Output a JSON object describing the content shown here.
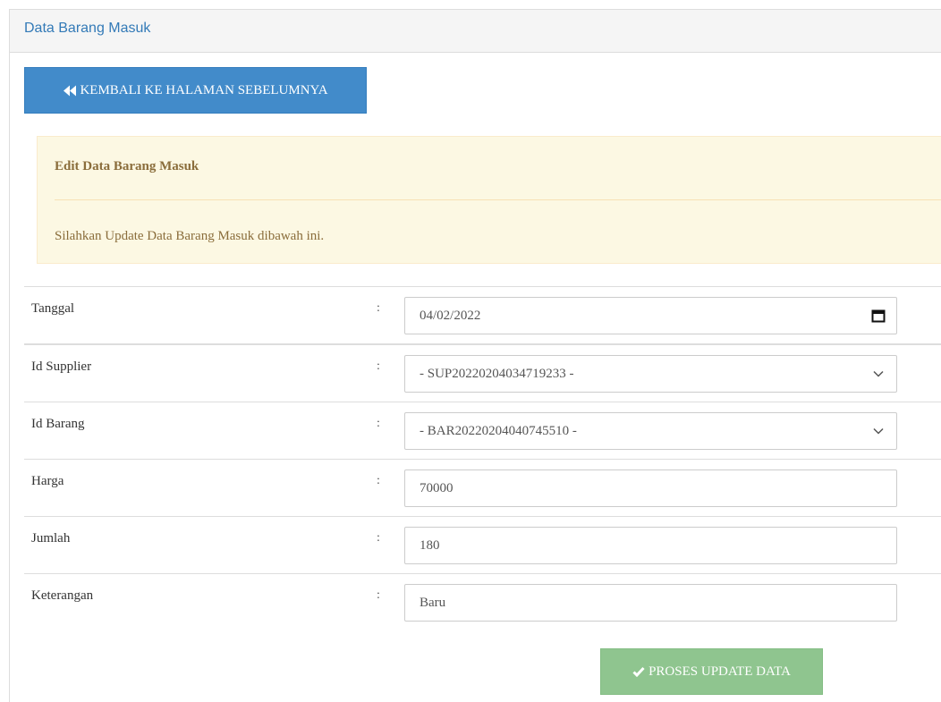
{
  "panel": {
    "title": "Data Barang Masuk"
  },
  "back_button": {
    "label": "KEMBALI KE HALAMAN SEBELUMNYA",
    "icon": "double-chevron-left-icon"
  },
  "alert": {
    "title": "Edit Data Barang Masuk",
    "message": "Silahkan Update Data Barang Masuk dibawah ini."
  },
  "form": {
    "separator": ":",
    "fields": [
      {
        "label": "Tanggal",
        "value": "04/02/2022",
        "type": "date"
      },
      {
        "label": "Id Supplier",
        "value": "- SUP20220204034719233 -",
        "type": "select"
      },
      {
        "label": "Id Barang",
        "value": "- BAR20220204040745510 -",
        "type": "select"
      },
      {
        "label": "Harga",
        "value": "70000",
        "type": "text"
      },
      {
        "label": "Jumlah",
        "value": "180",
        "type": "text"
      },
      {
        "label": "Keterangan",
        "value": "Baru",
        "type": "text"
      }
    ]
  },
  "submit_button": {
    "label": "PROSES UPDATE DATA",
    "icon": "check-icon"
  },
  "colors": {
    "primary": "#428bca",
    "success": "#8fc58f",
    "warning_bg": "#fcf8e3",
    "warning_text": "#8a6d3b",
    "title_link": "#337ab7"
  }
}
